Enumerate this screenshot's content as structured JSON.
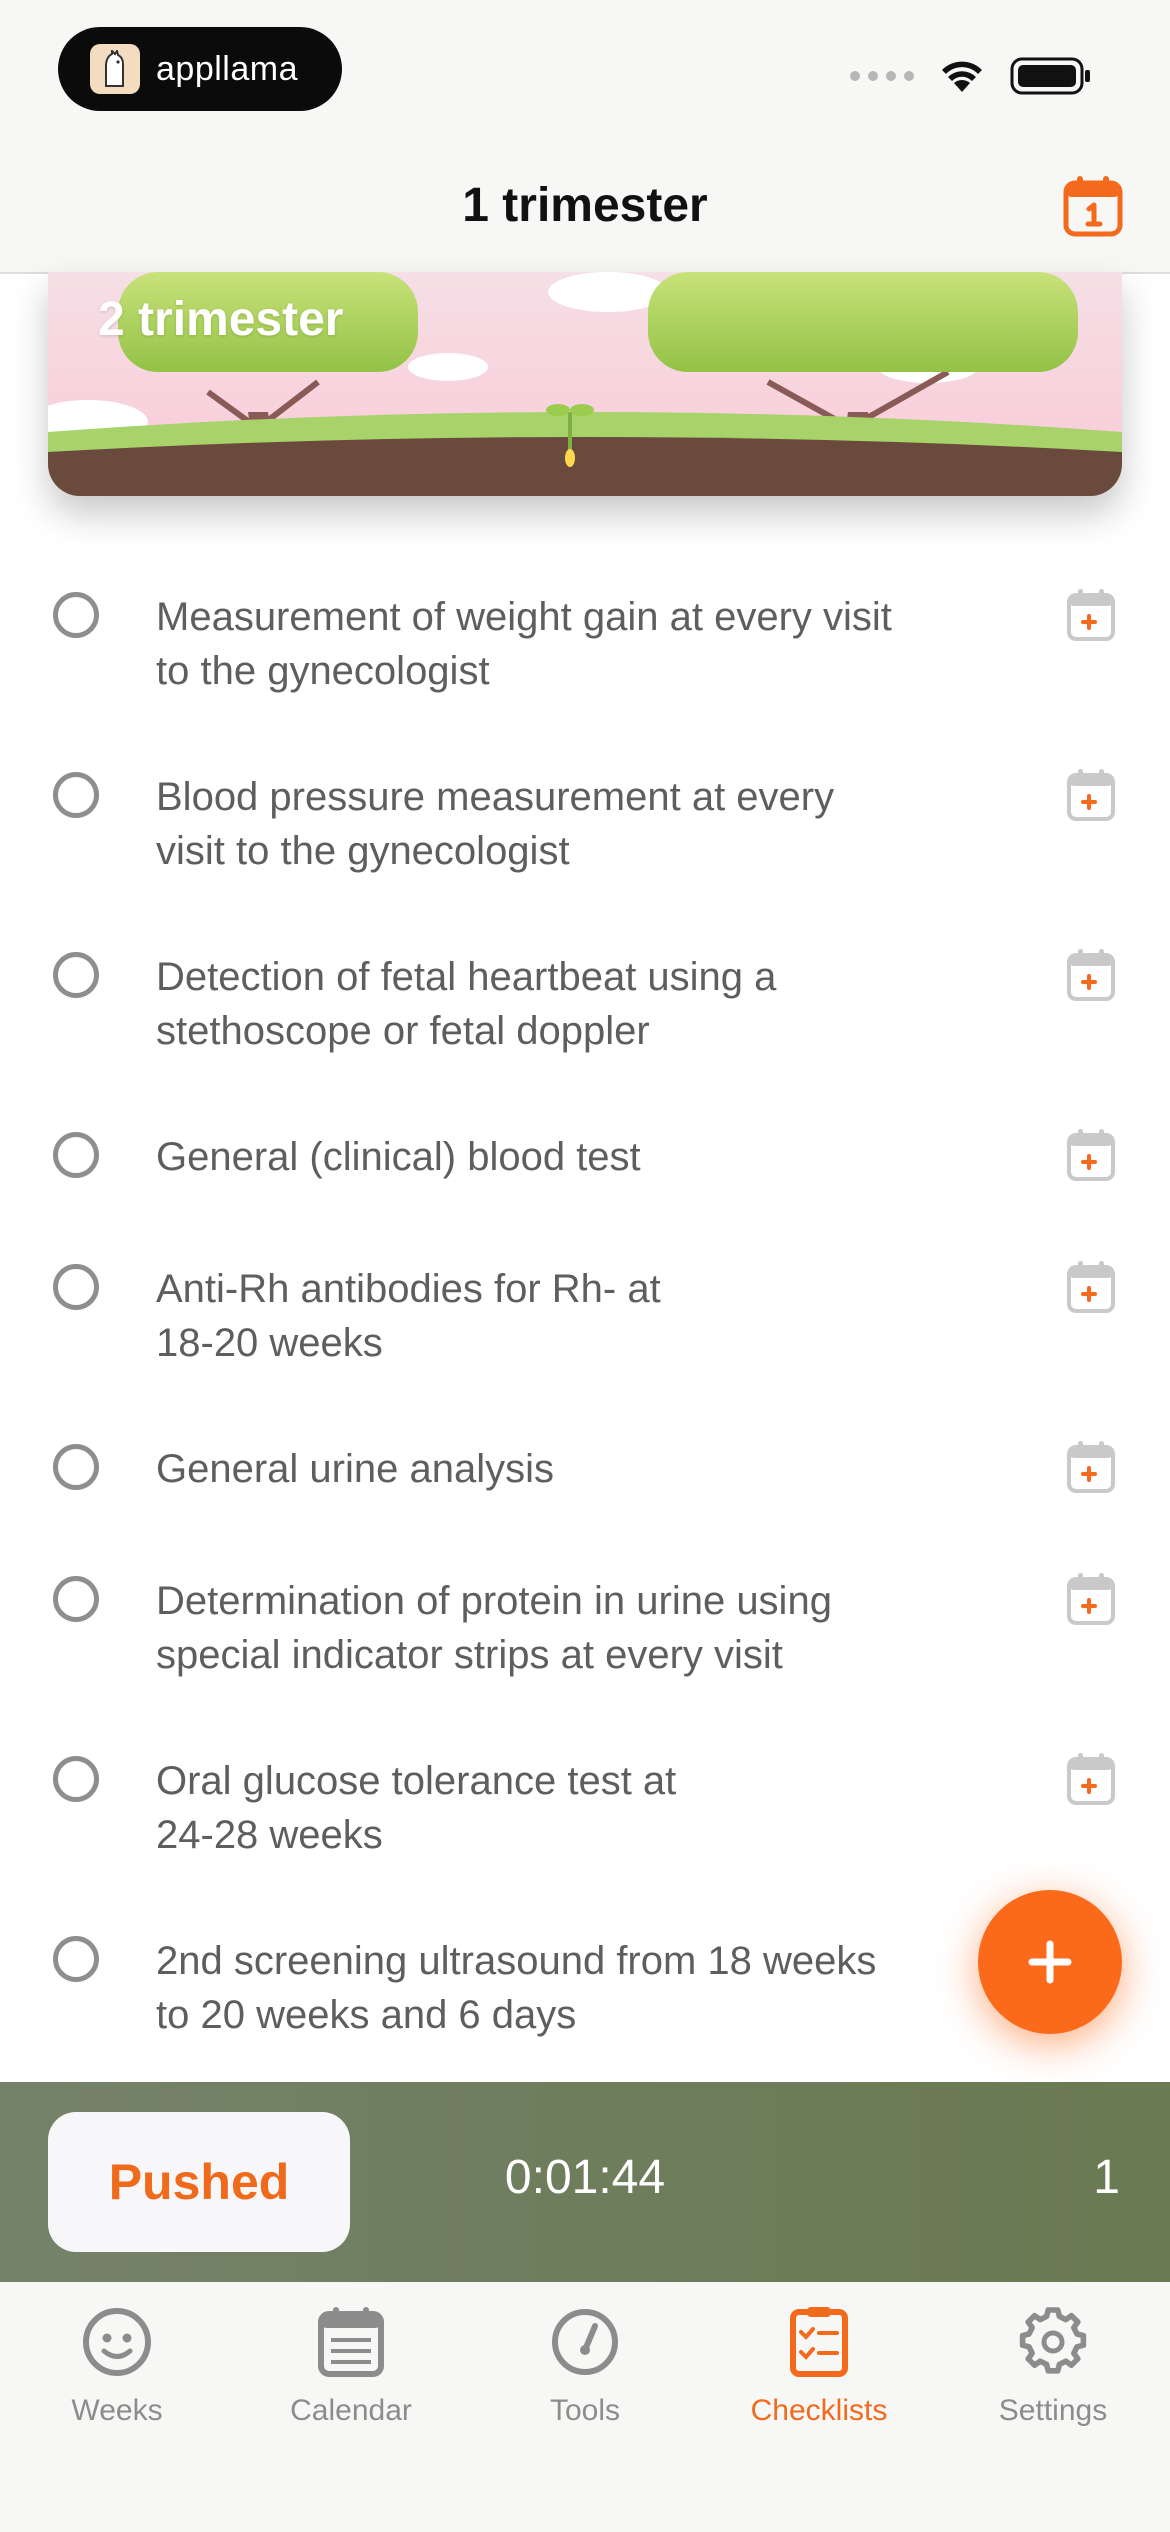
{
  "status_bar": {
    "brand": "appllama",
    "icons": [
      "signal-dots-icon",
      "wifi-icon",
      "battery-icon"
    ]
  },
  "nav": {
    "title": "1 trimester",
    "calendar_icon": "calendar-icon"
  },
  "banner": {
    "label": "2 trimester"
  },
  "checklist": [
    {
      "text_line1": "Measurement of weight gain at every visit",
      "text_line2": "to the gynecologist",
      "checked": false
    },
    {
      "text_line1": "Blood pressure measurement at every",
      "text_line2": "visit to the gynecologist",
      "checked": false
    },
    {
      "text_line1": "Detection of fetal heartbeat using a",
      "text_line2": "stethoscope or fetal doppler",
      "checked": false
    },
    {
      "text_line1": "General (clinical) blood test",
      "text_line2": "",
      "checked": false
    },
    {
      "text_line1": "Anti-Rh antibodies for Rh- at",
      "text_line2": "18-20 weeks",
      "checked": false
    },
    {
      "text_line1": "General urine analysis",
      "text_line2": "",
      "checked": false
    },
    {
      "text_line1": "Determination of protein in urine using",
      "text_line2": "special indicator strips at every visit",
      "checked": false
    },
    {
      "text_line1": "Oral glucose tolerance test at",
      "text_line2": "24-28 weeks",
      "checked": false
    },
    {
      "text_line1": "2nd screening ultrasound from 18 weeks",
      "text_line2": "to 20 weeks and 6 days",
      "checked": false
    }
  ],
  "fab": {
    "icon": "plus-icon"
  },
  "pushed_bar": {
    "button_label": "Pushed",
    "timer": "0:01:44",
    "count": "1"
  },
  "tabs": [
    {
      "label": "Weeks",
      "icon": "smiley-face-icon",
      "active": false
    },
    {
      "label": "Calendar",
      "icon": "calendar-icon",
      "active": false
    },
    {
      "label": "Tools",
      "icon": "gauge-icon",
      "active": false
    },
    {
      "label": "Checklists",
      "icon": "checklist-icon",
      "active": true
    },
    {
      "label": "Settings",
      "icon": "gear-icon",
      "active": false
    }
  ],
  "colors": {
    "accent": "#fb6a1a",
    "pushed_bar": "#6e7d5c",
    "text_secondary": "#5e5e5e"
  }
}
